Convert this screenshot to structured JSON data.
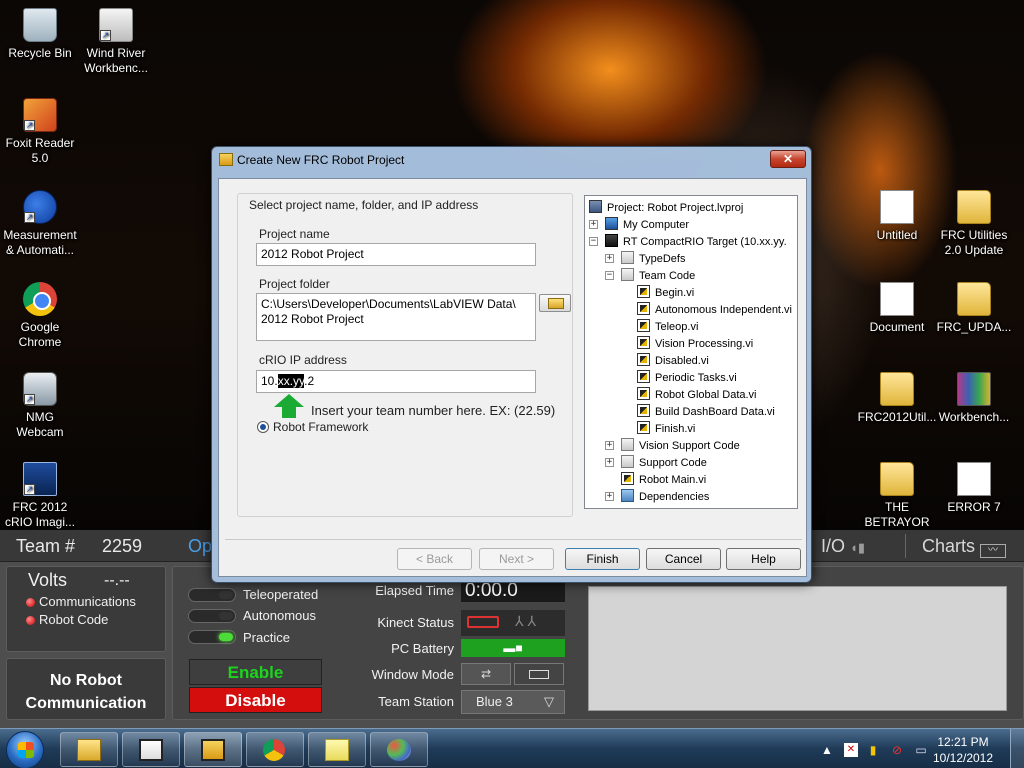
{
  "desktop": {
    "icons_left": [
      {
        "label": "Recycle Bin",
        "icon": "recycle-bin-icon"
      },
      {
        "label": "Wind River\nWorkbenc...",
        "icon": "wind-river-icon"
      },
      {
        "label": "Foxit Reader\n5.0",
        "icon": "foxit-reader-icon"
      },
      {
        "label": "Measurement\n& Automati...",
        "icon": "ni-max-icon"
      },
      {
        "label": "Google\nChrome",
        "icon": "chrome-icon"
      },
      {
        "label": "NMG\nWebcam",
        "icon": "webcam-icon"
      },
      {
        "label": "FRC 2012\ncRIO Imagi...",
        "icon": "frc-imaging-icon"
      }
    ],
    "icons_right": [
      {
        "label": "Untitled",
        "icon": "document-icon"
      },
      {
        "label": "FRC Utilities\n2.0 Update",
        "icon": "folder-icon"
      },
      {
        "label": "Document",
        "icon": "document-icon"
      },
      {
        "label": "FRC_UPDA...",
        "icon": "folder-icon"
      },
      {
        "label": "FRC2012Util...",
        "icon": "folder-icon"
      },
      {
        "label": "Workbench...",
        "icon": "winrar-icon"
      },
      {
        "label": "THE\nBETRAYOR",
        "icon": "folder-icon"
      },
      {
        "label": "ERROR 7",
        "icon": "text-file-icon"
      }
    ]
  },
  "dialog": {
    "title": "Create New FRC Robot Project",
    "close_label": "✕",
    "group_title": "Select project name, folder, and IP address",
    "project_name_label": "Project name",
    "project_name_value": "2012 Robot Project",
    "project_folder_label": "Project folder",
    "project_folder_value_line1": "C:\\Users\\Developer\\Documents\\LabVIEW Data\\",
    "project_folder_value_line2": "2012 Robot Project",
    "ip_label": "cRIO IP address",
    "ip_prefix": "10.",
    "ip_highlight": "xx.yy",
    "ip_suffix": ".2",
    "annotation": "Insert your team number here. EX: (22.59)",
    "framework_label": "Robot Framework",
    "buttons": {
      "back": "< Back",
      "next": "Next >",
      "finish": "Finish",
      "cancel": "Cancel",
      "help": "Help"
    },
    "tree": [
      "Project: Robot Project.lvproj",
      "My Computer",
      "RT CompactRIO Target (10.xx.yy.",
      "TypeDefs",
      "Team Code",
      "Begin.vi",
      "Autonomous Independent.vi",
      "Teleop.vi",
      "Vision Processing.vi",
      "Disabled.vi",
      "Periodic Tasks.vi",
      "Robot Global Data.vi",
      "Build DashBoard Data.vi",
      "Finish.vi",
      "Vision Support Code",
      "Support Code",
      "Robot Main.vi",
      "Dependencies"
    ]
  },
  "driver_station": {
    "team_label": "Team #",
    "team_number": "2259",
    "tab_operation_partial": "Op",
    "tab_io": "I/O",
    "tab_charts": "Charts",
    "volts_label": "Volts",
    "volts_value": "--.--",
    "status_communications": "Communications",
    "status_robot_code": "Robot Code",
    "no_comm_line1": "No Robot",
    "no_comm_line2": "Communication",
    "modes": [
      "Teleoperated",
      "Autonomous",
      "Practice"
    ],
    "selected_mode": "Practice",
    "enable_label": "Enable",
    "disable_label": "Disable",
    "elapsed_time_label": "Elapsed Time",
    "elapsed_time_value": "0:00.0",
    "kinect_status_label": "Kinect Status",
    "pc_battery_label": "PC Battery",
    "window_mode_label": "Window Mode",
    "team_station_label": "Team Station",
    "team_station_value": "Blue 3"
  },
  "taskbar": {
    "clock_time": "12:21 PM",
    "clock_date": "10/12/2012"
  },
  "colors": {
    "accent_green": "#4cdc37",
    "disable_red": "#d40d0d",
    "enable_green": "#1fd21f",
    "dialog_frame": "#aac4e2"
  }
}
